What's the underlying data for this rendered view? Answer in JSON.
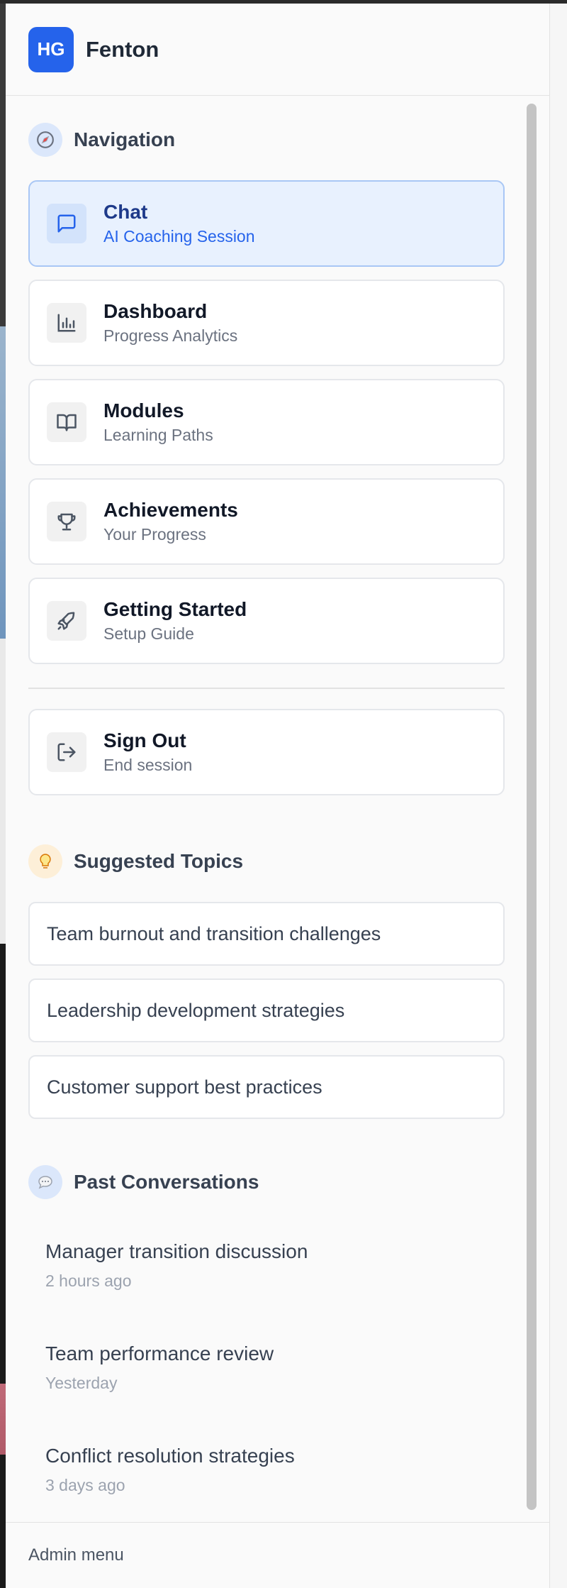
{
  "app": {
    "logo_initials": "HG",
    "brand_name": "Fenton"
  },
  "navigation": {
    "title": "Navigation",
    "icon": "compass-icon",
    "items": [
      {
        "label": "Chat",
        "sub": "AI Coaching Session",
        "icon": "chat-bubble-icon",
        "active": true
      },
      {
        "label": "Dashboard",
        "sub": "Progress Analytics",
        "icon": "bar-chart-icon",
        "active": false
      },
      {
        "label": "Modules",
        "sub": "Learning Paths",
        "icon": "open-book-icon",
        "active": false
      },
      {
        "label": "Achievements",
        "sub": "Your Progress",
        "icon": "trophy-icon",
        "active": false
      },
      {
        "label": "Getting Started",
        "sub": "Setup Guide",
        "icon": "rocket-icon",
        "active": false
      }
    ],
    "sign_out": {
      "label": "Sign Out",
      "sub": "End session",
      "icon": "sign-out-icon"
    }
  },
  "suggested_topics": {
    "title": "Suggested Topics",
    "icon": "lightbulb-icon",
    "items": [
      "Team burnout and transition challenges",
      "Leadership development strategies",
      "Customer support best practices"
    ]
  },
  "past_conversations": {
    "title": "Past Conversations",
    "icon": "speech-bubble-icon",
    "items": [
      {
        "title": "Manager transition discussion",
        "time": "2 hours ago"
      },
      {
        "title": "Team performance review",
        "time": "Yesterday"
      },
      {
        "title": "Conflict resolution strategies",
        "time": "3 days ago"
      }
    ]
  },
  "footer": {
    "label": "Admin menu"
  },
  "colors": {
    "accent": "#2563eb",
    "active_bg": "#e8f1fe",
    "active_border": "#a9c7f5"
  }
}
